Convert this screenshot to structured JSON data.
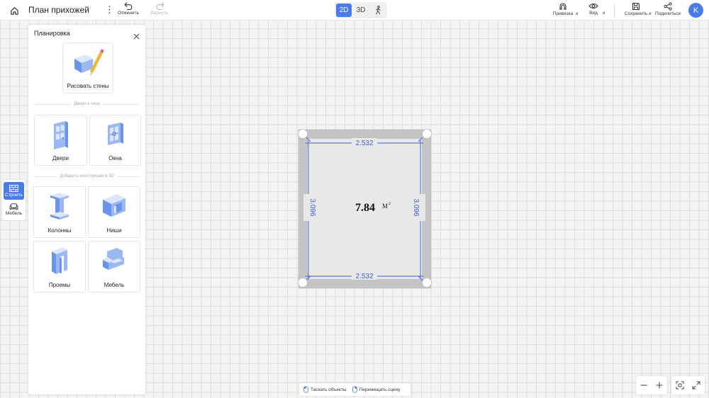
{
  "header": {
    "title": "План прихожей",
    "more_symbol": "⋮",
    "undo_label": "Отменить",
    "redo_label": "Вернуть",
    "view_modes": [
      "2D",
      "3D"
    ],
    "active_view": "2D",
    "snap_label": "Привязка",
    "view_label": "Вид",
    "save_label": "Сохранить",
    "share_label": "Поделиться",
    "avatar_letter": "K"
  },
  "leftbar": {
    "items": [
      {
        "label": "Строить",
        "icon": "wall-grid-icon",
        "active": true
      },
      {
        "label": "Мебель",
        "icon": "sofa-icon",
        "active": false
      }
    ]
  },
  "panel": {
    "title": "Планировка",
    "draw_walls_label": "Рисовать стены",
    "section_doors_windows": "Двери и окна",
    "doors_label": "Двери",
    "windows_label": "Окна",
    "section_constructions": "Добавить конструкции в 3D",
    "columns_label": "Колонны",
    "niches_label": "Ниши",
    "openings_label": "Проемы",
    "furniture_label": "Мебель"
  },
  "plan": {
    "area": "7.84",
    "area_unit": "M",
    "area_unit_sup": "2",
    "width_top": "2.532",
    "width_bottom": "2.532",
    "height_left": "3.096",
    "height_right": "3.096"
  },
  "hints": {
    "drag_objects": "Таскать объекты",
    "move_scene": "Перемещать сцену"
  },
  "colors": {
    "accent": "#4a7be6",
    "dimension": "#3b5fd4",
    "wall": "#c4c4c4",
    "floor": "#e8e8e8"
  }
}
